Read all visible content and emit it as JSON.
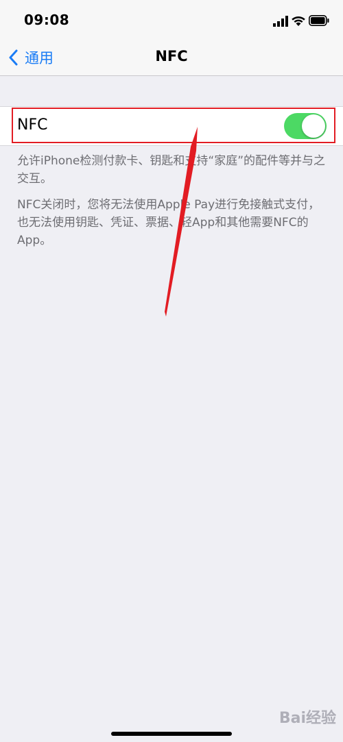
{
  "status_bar": {
    "time": "09:08"
  },
  "nav": {
    "back_label": "通用",
    "title": "NFC"
  },
  "nfc_row": {
    "label": "NFC",
    "toggle_on": true,
    "toggle_color": "#4cd964"
  },
  "footer": {
    "line1": "允许iPhone检测付款卡、钥匙和支持“家庭”的配件等并与之交互。",
    "line2": "NFC关闭时，您将无法使用Apple Pay进行免接触式支付，也无法使用钥匙、凭证、票据、轻App和其他需要NFC的App。"
  },
  "annotation": {
    "color": "#e21c23"
  },
  "watermark": {
    "text": "Bai经验"
  },
  "icons": [
    "back-chevron-icon",
    "signal-icon",
    "wifi-icon",
    "battery-icon"
  ]
}
